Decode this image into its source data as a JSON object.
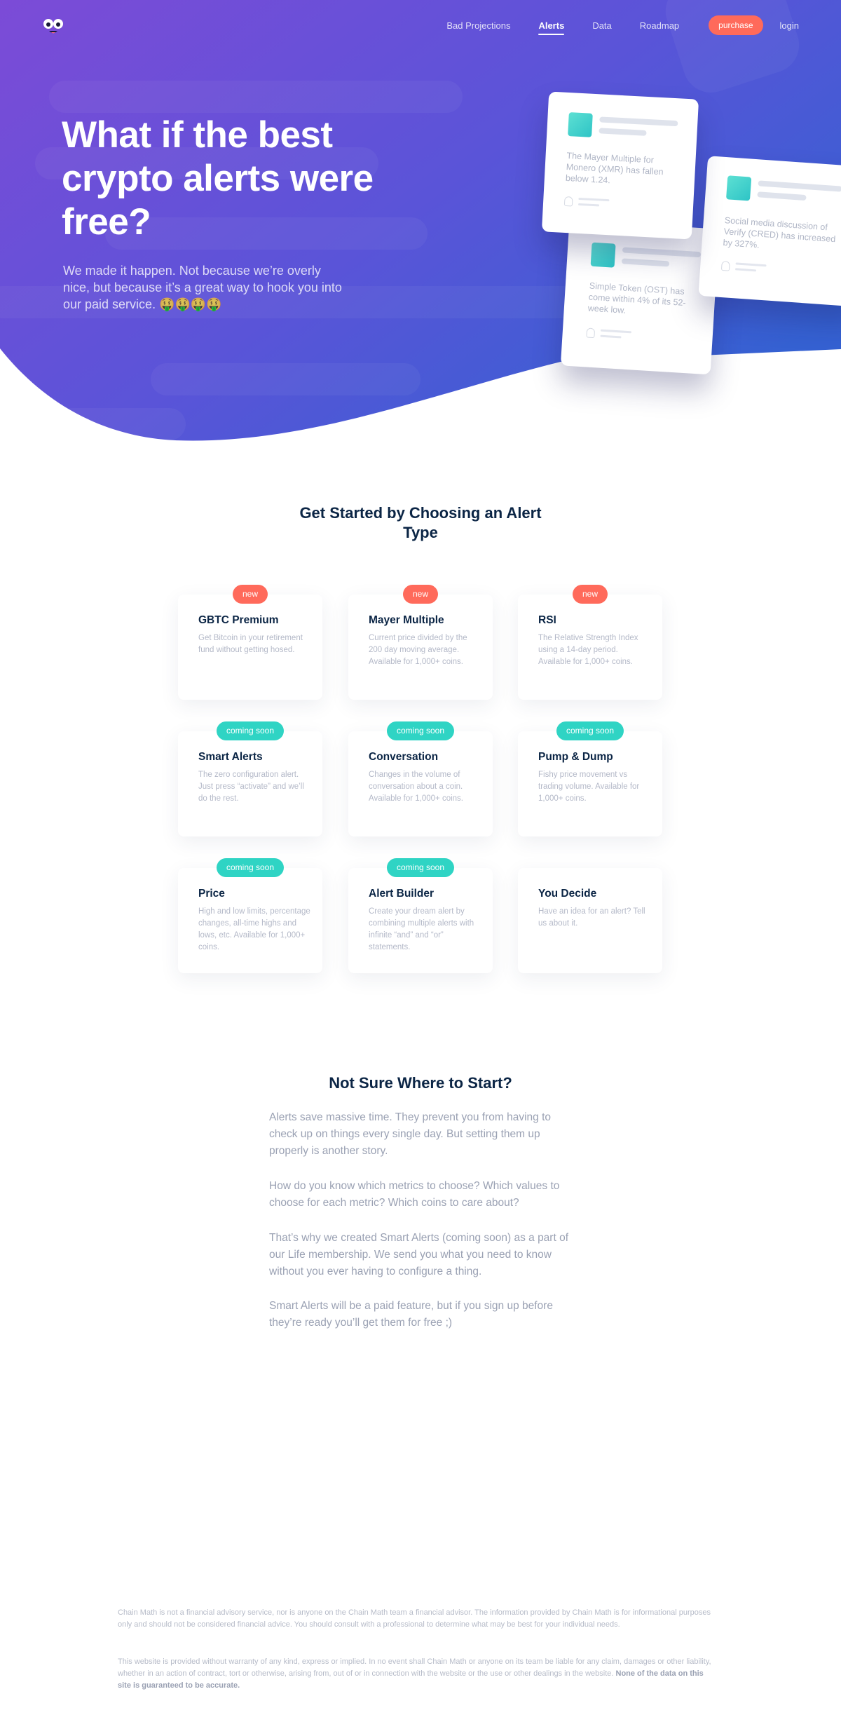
{
  "nav": {
    "links": [
      "Bad Projections",
      "Alerts",
      "Data",
      "Roadmap"
    ],
    "active": "Alerts",
    "purchase": "purchase",
    "login": "login"
  },
  "hero": {
    "title": "What if the best crypto alerts were free?",
    "subtitle": "We made it happen. Not because we’re overly nice, but because it’s a great way to hook you into our paid service. 🤑🤑🤑🤑"
  },
  "mock_alerts": [
    {
      "text": "The Mayer Multiple for Monero (XMR) has fallen below 1.24."
    },
    {
      "text": "Social media discussion of Verify (CRED) has increased by 327%."
    },
    {
      "text": "Simple Token (OST) has come within 4% of its 52-week low."
    }
  ],
  "alert_types": {
    "title": "Get Started by Choosing an Alert Type",
    "cards": [
      {
        "badge": "new",
        "title": "GBTC Premium",
        "desc": "Get Bitcoin in your retirement fund without getting hosed."
      },
      {
        "badge": "new",
        "title": "Mayer Multiple",
        "desc": "Current price divided by the 200 day moving average. Available for 1,000+ coins."
      },
      {
        "badge": "new",
        "title": "RSI",
        "desc": "The Relative Strength Index using a 14-day period. Available for 1,000+ coins."
      },
      {
        "badge": "coming soon",
        "title": "Smart Alerts",
        "desc": "The zero configuration alert. Just press “activate” and we’ll do the rest."
      },
      {
        "badge": "coming soon",
        "title": "Conversation",
        "desc": "Changes in the volume of conversation about a coin. Available for 1,000+ coins."
      },
      {
        "badge": "coming soon",
        "title": "Pump & Dump",
        "desc": "Fishy price movement vs trading volume. Available for 1,000+ coins."
      },
      {
        "badge": "coming soon",
        "title": "Price",
        "desc": "High and low limits, percentage changes, all-time highs and lows, etc. Available for 1,000+ coins."
      },
      {
        "badge": "coming soon",
        "title": "Alert Builder",
        "desc": "Create your dream alert by combining multiple alerts with infinite “and” and “or” statements."
      },
      {
        "badge": "",
        "title": "You Decide",
        "desc": "Have an idea for an alert? Tell us about it."
      }
    ]
  },
  "not_sure": {
    "title": "Not Sure Where to Start?",
    "paragraphs": [
      "Alerts save massive time. They prevent you from having to check up on things every single day. But setting them up properly is another story.",
      "How do you know which metrics to choose? Which values to choose for each metric? Which coins to care about?",
      "That’s why we created Smart Alerts (coming soon) as a part of our Life membership. We send you what you need to know without you ever having to configure a thing.",
      "Smart Alerts will be a paid feature, but if you sign up before they’re ready you’ll get them for free ;)"
    ]
  },
  "footer": {
    "disclaimer1": "Chain Math is not a financial advisory service, nor is anyone on the Chain Math team a financial advisor. The information provided by Chain Math is for informational purposes only and should not be considered financial advice. You should consult with a professional to determine what may be best for your individual needs.",
    "disclaimer2": "This website is provided without warranty of any kind, express or implied. In no event shall Chain Math or anyone on its team be liable for any claim, damages or other liability, whether in an action of contract, tort or otherwise, arising from, out of or in connection with the website or the use or other dealings in the website.",
    "disclaimer2_bold": "None of the data on this site is guaranteed to be accurate."
  },
  "colors": {
    "hero_gradient_start": "#7b4bd6",
    "hero_gradient_end": "#3a5fd4",
    "accent_coral": "#ff6a5b",
    "accent_teal": "#2fd4c4",
    "heading_navy": "#0b2545"
  }
}
